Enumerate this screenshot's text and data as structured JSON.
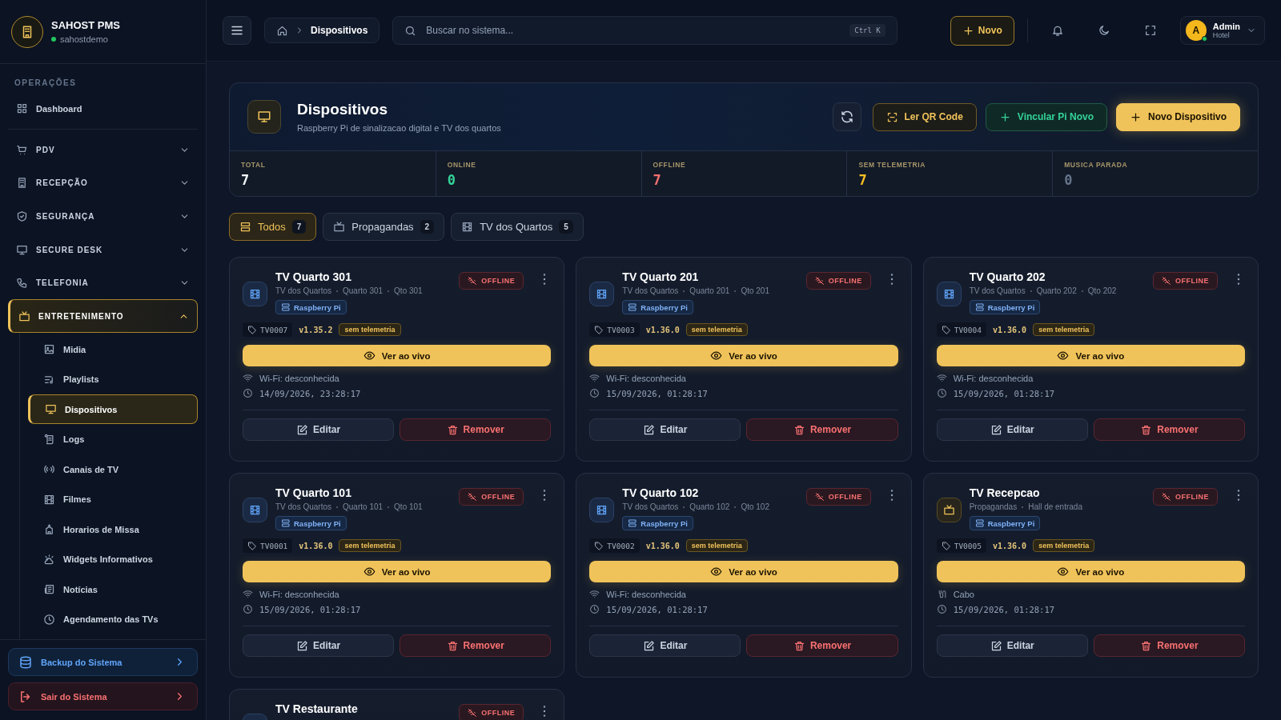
{
  "sidebar": {
    "brand": {
      "title": "SAHOST PMS",
      "subtitle": "sahostdemo",
      "online": true
    },
    "section_label": "OPERAÇÕES",
    "items": [
      {
        "label": "Dashboard",
        "kind": "link",
        "selected": false
      },
      {
        "label": "PDV",
        "kind": "group",
        "expanded": false
      },
      {
        "label": "RECEPÇÃO",
        "kind": "group",
        "expanded": false
      },
      {
        "label": "SEGURANÇA",
        "kind": "group",
        "expanded": false
      },
      {
        "label": "SECURE DESK",
        "kind": "group",
        "expanded": false
      },
      {
        "label": "TELEFONIA",
        "kind": "group",
        "expanded": false
      },
      {
        "label": "ENTRETENIMENTO",
        "kind": "group",
        "expanded": true,
        "children": [
          {
            "label": "Midia",
            "selected": false
          },
          {
            "label": "Playlists",
            "selected": false
          },
          {
            "label": "Dispositivos",
            "selected": true
          },
          {
            "label": "Logs",
            "selected": false
          },
          {
            "label": "Canais de TV",
            "selected": false
          },
          {
            "label": "Filmes",
            "selected": false
          },
          {
            "label": "Horarios de Missa",
            "selected": false
          },
          {
            "label": "Widgets Informativos",
            "selected": false
          },
          {
            "label": "Notícias",
            "selected": false
          },
          {
            "label": "Agendamento das TVs",
            "selected": false
          }
        ]
      }
    ],
    "footer": [
      {
        "label": "Backup do Sistema",
        "kind": "backup"
      },
      {
        "label": "Sair do Sistema",
        "kind": "logout"
      }
    ]
  },
  "topbar": {
    "breadcrumb": "Dispositivos",
    "search": {
      "placeholder": "Buscar no sistema...",
      "shortcut": "Ctrl K"
    },
    "new_button": "Novo",
    "user": {
      "initial": "A",
      "name": "Admin",
      "role": "Hotel",
      "online": true
    }
  },
  "page": {
    "title": "Dispositivos",
    "subtitle": "Raspberry Pi de sinalizacao digital e TV dos quartos",
    "actions": [
      {
        "label": "Ler QR Code",
        "kind": "qr"
      },
      {
        "label": "Vincular Pi Novo",
        "kind": "pair"
      },
      {
        "label": "Novo Dispositivo",
        "kind": "primary"
      }
    ],
    "stats": [
      {
        "label": "TOTAL",
        "value": "7",
        "color": "#f1f5f9"
      },
      {
        "label": "ONLINE",
        "value": "0",
        "color": "#34d399"
      },
      {
        "label": "OFFLINE",
        "value": "7",
        "color": "#f87171"
      },
      {
        "label": "SEM TELEMETRIA",
        "value": "7",
        "color": "#fbbf24"
      },
      {
        "label": "MUSICA PARADA",
        "value": "0",
        "color": "#64748b"
      }
    ],
    "filters": [
      {
        "label": "Todos",
        "count": "7",
        "selected": true
      },
      {
        "label": "Propagandas",
        "count": "2",
        "selected": false
      },
      {
        "label": "TV dos Quartos",
        "count": "5",
        "selected": false
      }
    ],
    "devices": [
      {
        "name": "TV Quarto 301",
        "kind": "room",
        "meta": [
          "TV dos Quartos",
          "Quarto 301",
          "Qto 301"
        ],
        "platform": "Raspberry Pi",
        "status": "OFFLINE",
        "online": false,
        "code": "TV0007",
        "version": "v1.35.2",
        "telemetry": "sem telemetria",
        "live_button": "Ver ao vivo",
        "connection": {
          "kind": "wifi",
          "text": "Wi-Fi: desconhecida"
        },
        "last_seen": "14/09/2026, 23:28:17",
        "edit": "Editar",
        "remove": "Remover"
      },
      {
        "name": "TV Quarto 201",
        "kind": "room",
        "meta": [
          "TV dos Quartos",
          "Quarto 201",
          "Qto 201"
        ],
        "platform": "Raspberry Pi",
        "status": "OFFLINE",
        "online": false,
        "code": "TV0003",
        "version": "v1.36.0",
        "telemetry": "sem telemetria",
        "live_button": "Ver ao vivo",
        "connection": {
          "kind": "wifi",
          "text": "Wi-Fi: desconhecida"
        },
        "last_seen": "15/09/2026, 01:28:17",
        "edit": "Editar",
        "remove": "Remover"
      },
      {
        "name": "TV Quarto 202",
        "kind": "room",
        "meta": [
          "TV dos Quartos",
          "Quarto 202",
          "Qto 202"
        ],
        "platform": "Raspberry Pi",
        "status": "OFFLINE",
        "online": false,
        "code": "TV0004",
        "version": "v1.36.0",
        "telemetry": "sem telemetria",
        "live_button": "Ver ao vivo",
        "connection": {
          "kind": "wifi",
          "text": "Wi-Fi: desconhecida"
        },
        "last_seen": "15/09/2026, 01:28:17",
        "edit": "Editar",
        "remove": "Remover"
      },
      {
        "name": "TV Quarto 101",
        "kind": "room",
        "meta": [
          "TV dos Quartos",
          "Quarto 101",
          "Qto 101"
        ],
        "platform": "Raspberry Pi",
        "status": "OFFLINE",
        "online": false,
        "code": "TV0001",
        "version": "v1.36.0",
        "telemetry": "sem telemetria",
        "live_button": "Ver ao vivo",
        "connection": {
          "kind": "wifi",
          "text": "Wi-Fi: desconhecida"
        },
        "last_seen": "15/09/2026, 01:28:17",
        "edit": "Editar",
        "remove": "Remover"
      },
      {
        "name": "TV Quarto 102",
        "kind": "room",
        "meta": [
          "TV dos Quartos",
          "Quarto 102",
          "Qto 102"
        ],
        "platform": "Raspberry Pi",
        "status": "OFFLINE",
        "online": false,
        "code": "TV0002",
        "version": "v1.36.0",
        "telemetry": "sem telemetria",
        "live_button": "Ver ao vivo",
        "connection": {
          "kind": "wifi",
          "text": "Wi-Fi: desconhecida"
        },
        "last_seen": "15/09/2026, 01:28:17",
        "edit": "Editar",
        "remove": "Remover"
      },
      {
        "name": "TV Recepcao",
        "kind": "ad",
        "meta": [
          "Propagandas",
          "Hall de entrada"
        ],
        "platform": "Raspberry Pi",
        "status": "OFFLINE",
        "online": false,
        "code": "TV0005",
        "version": "v1.36.0",
        "telemetry": "sem telemetria",
        "live_button": "Ver ao vivo",
        "connection": {
          "kind": "cable",
          "text": "Cabo"
        },
        "last_seen": "15/09/2026, 01:28:17",
        "edit": "Editar",
        "remove": "Remover"
      },
      {
        "name": "TV Restaurante",
        "status": "OFFLINE",
        "online": false
      }
    ]
  }
}
